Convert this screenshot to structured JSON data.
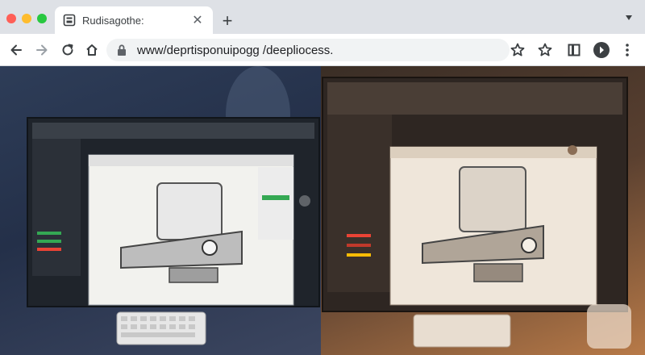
{
  "window": {
    "traffic_lights": [
      {
        "name": "close",
        "color": "#ff5f57"
      },
      {
        "name": "minimize",
        "color": "#febc2e"
      },
      {
        "name": "maximize",
        "color": "#28c840"
      }
    ]
  },
  "tab": {
    "title": "Rudisagothe:",
    "close_glyph": "✕"
  },
  "toolbar": {
    "url": "www/deprtisponuipogg /deepliocess.",
    "new_tab_glyph": "+",
    "menu_glyph": "▾"
  },
  "icons": {
    "back": "back-arrow-icon",
    "forward": "forward-arrow-icon",
    "reload": "reload-icon",
    "home": "home-icon",
    "lock": "lock-icon",
    "star": "star-icon",
    "bookmark": "bookmark-star-icon",
    "reading_list": "reading-list-icon",
    "extension": "extension-icon",
    "more": "more-vert-icon"
  },
  "colors": {
    "chrome_bg": "#dee1e6",
    "toolbar_bg": "#ffffff",
    "omnibox_bg": "#f1f3f4"
  }
}
